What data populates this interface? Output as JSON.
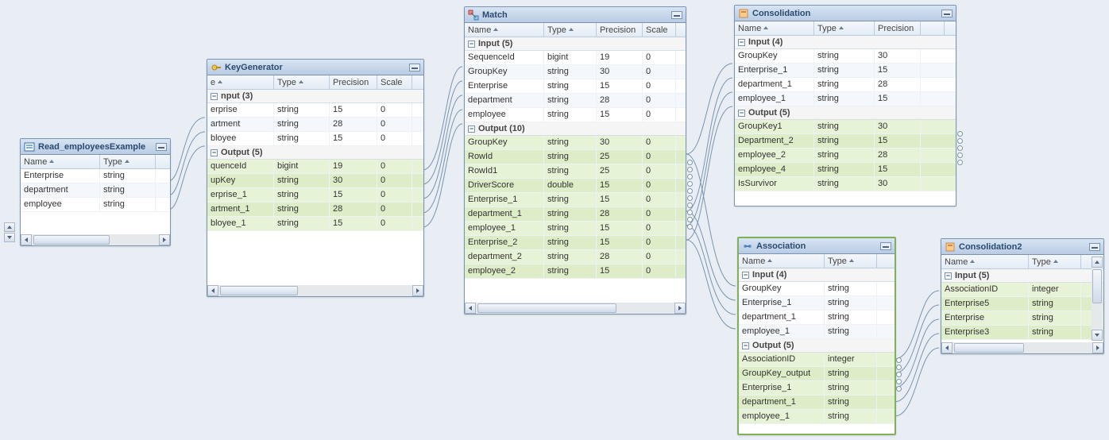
{
  "headers": {
    "name": "Name",
    "type": "Type",
    "precision": "Precision",
    "scale": "Scale",
    "name_short": "e"
  },
  "nodes": {
    "read": {
      "title": "Read_employeesExample",
      "rows": [
        {
          "name": "Enterprise",
          "type": "string"
        },
        {
          "name": "department",
          "type": "string"
        },
        {
          "name": "employee",
          "type": "string"
        }
      ]
    },
    "keygen": {
      "title": "KeyGenerator",
      "input_label": "nput (3)",
      "output_label": "Output (5)",
      "input": [
        {
          "name": "erprise",
          "type": "string",
          "prec": "15",
          "scale": "0"
        },
        {
          "name": "artment",
          "type": "string",
          "prec": "28",
          "scale": "0"
        },
        {
          "name": "bloyee",
          "type": "string",
          "prec": "15",
          "scale": "0"
        }
      ],
      "output": [
        {
          "name": "quenceId",
          "type": "bigint",
          "prec": "19",
          "scale": "0"
        },
        {
          "name": "upKey",
          "type": "string",
          "prec": "30",
          "scale": "0"
        },
        {
          "name": "erprise_1",
          "type": "string",
          "prec": "15",
          "scale": "0"
        },
        {
          "name": "artment_1",
          "type": "string",
          "prec": "28",
          "scale": "0"
        },
        {
          "name": "bloyee_1",
          "type": "string",
          "prec": "15",
          "scale": "0"
        }
      ]
    },
    "match": {
      "title": "Match",
      "input_label": "Input (5)",
      "output_label": "Output (10)",
      "input": [
        {
          "name": "SequenceId",
          "type": "bigint",
          "prec": "19",
          "scale": "0"
        },
        {
          "name": "GroupKey",
          "type": "string",
          "prec": "30",
          "scale": "0"
        },
        {
          "name": "Enterprise",
          "type": "string",
          "prec": "15",
          "scale": "0"
        },
        {
          "name": "department",
          "type": "string",
          "prec": "28",
          "scale": "0"
        },
        {
          "name": "employee",
          "type": "string",
          "prec": "15",
          "scale": "0"
        }
      ],
      "output": [
        {
          "name": "GroupKey",
          "type": "string",
          "prec": "30",
          "scale": "0"
        },
        {
          "name": "RowId",
          "type": "string",
          "prec": "25",
          "scale": "0"
        },
        {
          "name": "RowId1",
          "type": "string",
          "prec": "25",
          "scale": "0"
        },
        {
          "name": "DriverScore",
          "type": "double",
          "prec": "15",
          "scale": "0"
        },
        {
          "name": "Enterprise_1",
          "type": "string",
          "prec": "15",
          "scale": "0"
        },
        {
          "name": "department_1",
          "type": "string",
          "prec": "28",
          "scale": "0"
        },
        {
          "name": "employee_1",
          "type": "string",
          "prec": "15",
          "scale": "0"
        },
        {
          "name": "Enterprise_2",
          "type": "string",
          "prec": "15",
          "scale": "0"
        },
        {
          "name": "department_2",
          "type": "string",
          "prec": "28",
          "scale": "0"
        },
        {
          "name": "employee_2",
          "type": "string",
          "prec": "15",
          "scale": "0"
        }
      ]
    },
    "consol": {
      "title": "Consolidation",
      "input_label": "Input (4)",
      "output_label": "Output (5)",
      "input": [
        {
          "name": "GroupKey",
          "type": "string",
          "prec": "30"
        },
        {
          "name": "Enterprise_1",
          "type": "string",
          "prec": "15"
        },
        {
          "name": "department_1",
          "type": "string",
          "prec": "28"
        },
        {
          "name": "employee_1",
          "type": "string",
          "prec": "15"
        }
      ],
      "output": [
        {
          "name": "GroupKey1",
          "type": "string",
          "prec": "30"
        },
        {
          "name": "Department_2",
          "type": "string",
          "prec": "15"
        },
        {
          "name": "employee_2",
          "type": "string",
          "prec": "28"
        },
        {
          "name": "employee_4",
          "type": "string",
          "prec": "15"
        },
        {
          "name": "IsSurvivor",
          "type": "string",
          "prec": "30"
        }
      ]
    },
    "assoc": {
      "title": "Association",
      "input_label": "Input (4)",
      "output_label": "Output (5)",
      "input": [
        {
          "name": "GroupKey",
          "type": "string"
        },
        {
          "name": "Enterprise_1",
          "type": "string"
        },
        {
          "name": "department_1",
          "type": "string"
        },
        {
          "name": "employee_1",
          "type": "string"
        }
      ],
      "output": [
        {
          "name": "AssociationID",
          "type": "integer"
        },
        {
          "name": "GroupKey_output",
          "type": "string"
        },
        {
          "name": "Enterprise_1",
          "type": "string"
        },
        {
          "name": "department_1",
          "type": "string"
        },
        {
          "name": "employee_1",
          "type": "string"
        }
      ]
    },
    "consol2": {
      "title": "Consolidation2",
      "input_label": "Input (5)",
      "input": [
        {
          "name": "AssociationID",
          "type": "integer"
        },
        {
          "name": "Enterprise5",
          "type": "string"
        },
        {
          "name": "Enterprise",
          "type": "string"
        },
        {
          "name": "Enterprise3",
          "type": "string"
        }
      ]
    }
  }
}
